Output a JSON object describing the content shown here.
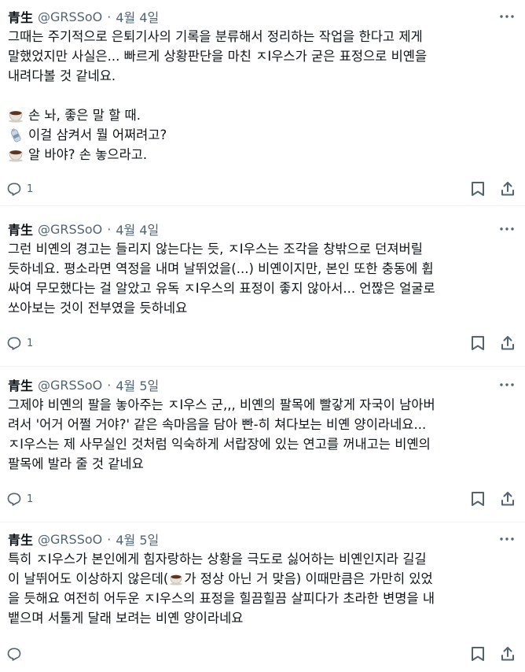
{
  "posts": [
    {
      "author_name": "青生",
      "handle": "@GRSSoO",
      "separator": "·",
      "date": "4월 4일",
      "lines": [
        "그때는 주기적으로 은퇴기사의 기록을 분류해서 정리하는 작업을 한다고 제게",
        "말했었지만 사실은... 빠르게 상황판단을 마친 ㅈI우스가 굳은 표정으로 비옌을",
        "내려다볼 것 같네요."
      ],
      "dialogue": [
        {
          "icon": "coffee-cup-icon",
          "text": "손 놔, 좋은 말 할 때."
        },
        {
          "icon": "bottle-icon",
          "text": "이걸 삼켜서 뭘 어쩌려고?"
        },
        {
          "icon": "coffee-cup-icon",
          "text": "알 바야? 손 놓으라고."
        }
      ],
      "reply_count": "1"
    },
    {
      "author_name": "青生",
      "handle": "@GRSSoO",
      "separator": "·",
      "date": "4월 4일",
      "lines": [
        "그런 비옌의 경고는 들리지 않는다는 듯, ㅈI우스는 조각을 창밖으로 던져버릴",
        "듯하네요. 평소라면 역정을 내며 날뛰었을(...) 비옌이지만, 본인 또한 충동에 휩",
        "싸여 무모했다는 걸 알았고 유독 ㅈI우스의 표정이 좋지 않아서... 언짢은 얼굴로",
        "쏘아보는 것이 전부였을 듯하네요"
      ],
      "reply_count": "1"
    },
    {
      "author_name": "青生",
      "handle": "@GRSSoO",
      "separator": "·",
      "date": "4월 5일",
      "lines": [
        "그제야 비옌의 팔을 놓아주는 ㅈI우스 군,,, 비옌의 팔목에 빨갛게 자국이 남아버",
        "려서 '어거 어쩔 거야?' 같은 속마음을 담아 빤-히 쳐다보는 비옌 양이라네요...",
        "ㅈI우스는 제 사무실인 것처럼 익숙하게 서랍장에 있는 연고를 꺼내고는 비옌의",
        "팔목에 발라 줄 것 같네요"
      ],
      "reply_count": "1"
    },
    {
      "author_name": "青生",
      "handle": "@GRSSoO",
      "separator": "·",
      "date": "4월 5일",
      "lines": [
        "특히 ㅈI우스가 본인에게 힘자랑하는 상황을 극도로 싫어하는 비옌인지라 길길",
        "이 날뛰어도 이상하지 않은데(",
        "가 정상 아닌 거 맞음) 이때만큼은 가만히 있었",
        "을 듯해요 여전히 어두운 ㅈI우스의 표정을 힐끔힐끔 살피다가 초라한 변명을 내",
        "뱉으며 서툴게 달래 보려는 비옌 양이라네요"
      ],
      "reply_count": ""
    }
  ],
  "colors": {
    "text": "#0f1419",
    "secondary": "#536471",
    "divider": "#eff3f4",
    "cup": "#7a4a2a"
  }
}
